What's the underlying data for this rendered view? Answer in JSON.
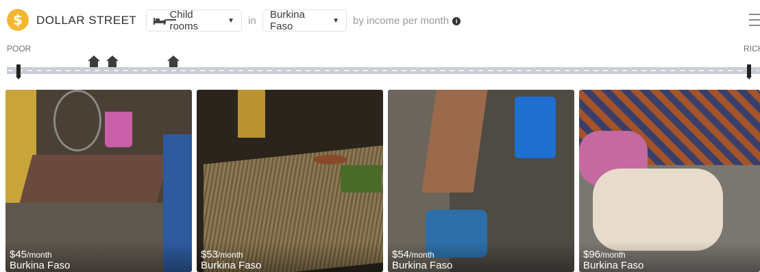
{
  "header": {
    "brand": "DOLLAR STREET",
    "logo_symbol": "$",
    "things_filter": "Child rooms",
    "connector_in": "in",
    "country_filter": "Burkina Faso",
    "sort_text": "by income per month",
    "info_symbol": "i"
  },
  "scale": {
    "left_label": "POOR",
    "right_label": "RICH"
  },
  "photos": [
    {
      "income": "$45",
      "unit": "/month",
      "country": "Burkina Faso"
    },
    {
      "income": "$53",
      "unit": "/month",
      "country": "Burkina Faso"
    },
    {
      "income": "$54",
      "unit": "/month",
      "country": "Burkina Faso"
    },
    {
      "income": "$96",
      "unit": "/month",
      "country": "Burkina Faso"
    }
  ],
  "colors": {
    "logo": "#f5b731",
    "track": "#c9ced4",
    "handle": "#222222"
  }
}
